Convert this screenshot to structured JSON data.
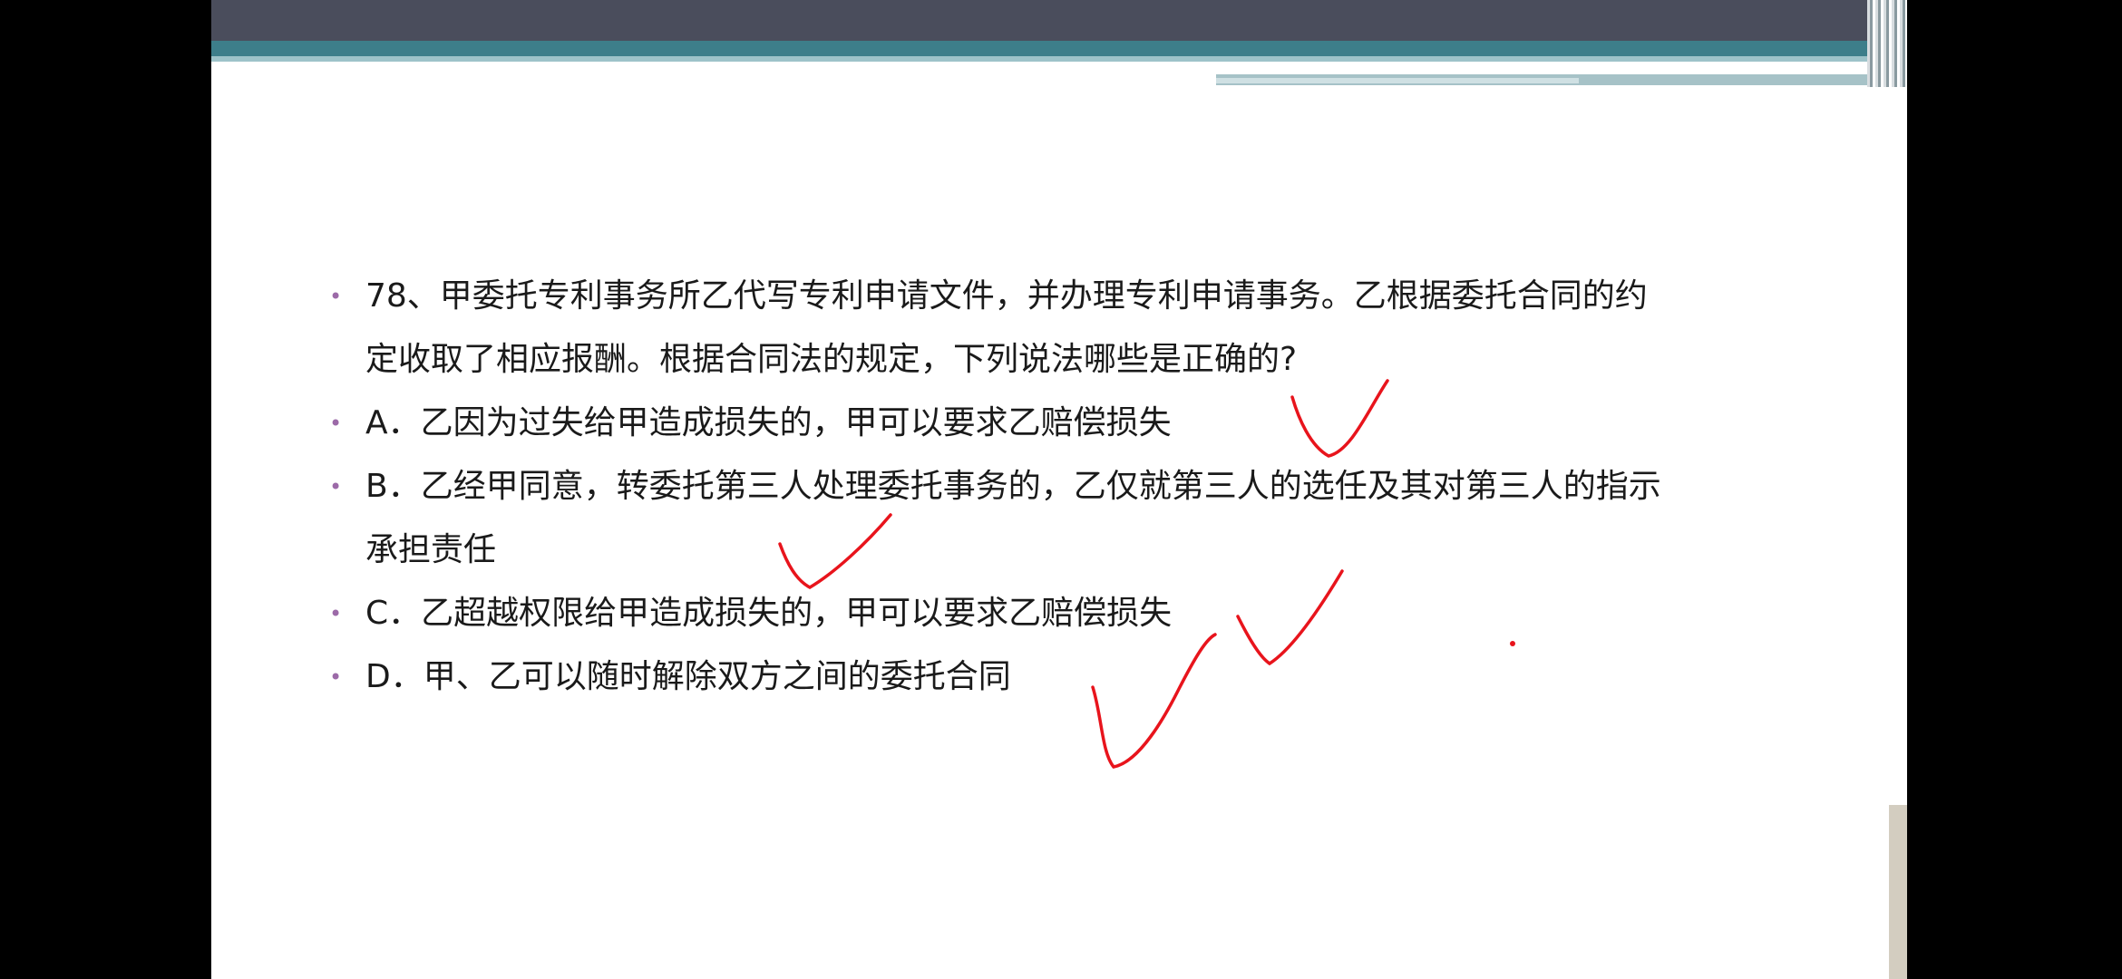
{
  "question": {
    "stem": "78、甲委托专利事务所乙代写专利申请文件，并办理专利申请事务。乙根据委托合同的约定收取了相应报酬。根据合同法的规定，下列说法哪些是正确的?",
    "options": [
      {
        "label": "A．乙因为过失给甲造成损失的，甲可以要求乙赔偿损失"
      },
      {
        "label": "B．乙经甲同意，转委托第三人处理委托事务的，乙仅就第三人的选任及其对第三人的指示承担责任"
      },
      {
        "label": "C．乙超越权限给甲造成损失的，甲可以要求乙赔偿损失"
      },
      {
        "label": "D．甲、乙可以随时解除双方之间的委托合同"
      }
    ]
  },
  "bullet_symbol": "•",
  "colors": {
    "header_dark": "#4a4d5c",
    "header_teal": "#3d7e8a",
    "bullet": "#9c6aa8",
    "ink": "#e8141c"
  },
  "annotations": [
    "check-mark-A",
    "check-mark-B",
    "check-mark-C",
    "check-mark-D"
  ],
  "presenter": {
    "icon": "presenter-video-thumbnail"
  }
}
